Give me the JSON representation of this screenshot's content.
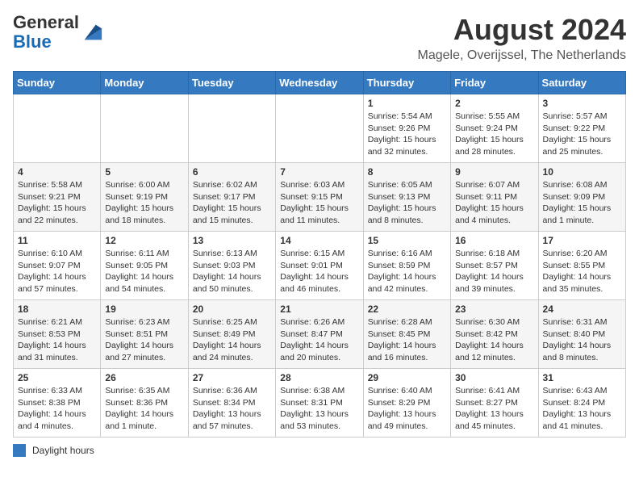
{
  "logo": {
    "general": "General",
    "blue": "Blue"
  },
  "title": "August 2024",
  "subtitle": "Magele, Overijssel, The Netherlands",
  "weekdays": [
    "Sunday",
    "Monday",
    "Tuesday",
    "Wednesday",
    "Thursday",
    "Friday",
    "Saturday"
  ],
  "weeks": [
    [
      {
        "day": "",
        "sunrise": "",
        "sunset": "",
        "daylight": ""
      },
      {
        "day": "",
        "sunrise": "",
        "sunset": "",
        "daylight": ""
      },
      {
        "day": "",
        "sunrise": "",
        "sunset": "",
        "daylight": ""
      },
      {
        "day": "",
        "sunrise": "",
        "sunset": "",
        "daylight": ""
      },
      {
        "day": "1",
        "sunrise": "Sunrise: 5:54 AM",
        "sunset": "Sunset: 9:26 PM",
        "daylight": "Daylight: 15 hours and 32 minutes."
      },
      {
        "day": "2",
        "sunrise": "Sunrise: 5:55 AM",
        "sunset": "Sunset: 9:24 PM",
        "daylight": "Daylight: 15 hours and 28 minutes."
      },
      {
        "day": "3",
        "sunrise": "Sunrise: 5:57 AM",
        "sunset": "Sunset: 9:22 PM",
        "daylight": "Daylight: 15 hours and 25 minutes."
      }
    ],
    [
      {
        "day": "4",
        "sunrise": "Sunrise: 5:58 AM",
        "sunset": "Sunset: 9:21 PM",
        "daylight": "Daylight: 15 hours and 22 minutes."
      },
      {
        "day": "5",
        "sunrise": "Sunrise: 6:00 AM",
        "sunset": "Sunset: 9:19 PM",
        "daylight": "Daylight: 15 hours and 18 minutes."
      },
      {
        "day": "6",
        "sunrise": "Sunrise: 6:02 AM",
        "sunset": "Sunset: 9:17 PM",
        "daylight": "Daylight: 15 hours and 15 minutes."
      },
      {
        "day": "7",
        "sunrise": "Sunrise: 6:03 AM",
        "sunset": "Sunset: 9:15 PM",
        "daylight": "Daylight: 15 hours and 11 minutes."
      },
      {
        "day": "8",
        "sunrise": "Sunrise: 6:05 AM",
        "sunset": "Sunset: 9:13 PM",
        "daylight": "Daylight: 15 hours and 8 minutes."
      },
      {
        "day": "9",
        "sunrise": "Sunrise: 6:07 AM",
        "sunset": "Sunset: 9:11 PM",
        "daylight": "Daylight: 15 hours and 4 minutes."
      },
      {
        "day": "10",
        "sunrise": "Sunrise: 6:08 AM",
        "sunset": "Sunset: 9:09 PM",
        "daylight": "Daylight: 15 hours and 1 minute."
      }
    ],
    [
      {
        "day": "11",
        "sunrise": "Sunrise: 6:10 AM",
        "sunset": "Sunset: 9:07 PM",
        "daylight": "Daylight: 14 hours and 57 minutes."
      },
      {
        "day": "12",
        "sunrise": "Sunrise: 6:11 AM",
        "sunset": "Sunset: 9:05 PM",
        "daylight": "Daylight: 14 hours and 54 minutes."
      },
      {
        "day": "13",
        "sunrise": "Sunrise: 6:13 AM",
        "sunset": "Sunset: 9:03 PM",
        "daylight": "Daylight: 14 hours and 50 minutes."
      },
      {
        "day": "14",
        "sunrise": "Sunrise: 6:15 AM",
        "sunset": "Sunset: 9:01 PM",
        "daylight": "Daylight: 14 hours and 46 minutes."
      },
      {
        "day": "15",
        "sunrise": "Sunrise: 6:16 AM",
        "sunset": "Sunset: 8:59 PM",
        "daylight": "Daylight: 14 hours and 42 minutes."
      },
      {
        "day": "16",
        "sunrise": "Sunrise: 6:18 AM",
        "sunset": "Sunset: 8:57 PM",
        "daylight": "Daylight: 14 hours and 39 minutes."
      },
      {
        "day": "17",
        "sunrise": "Sunrise: 6:20 AM",
        "sunset": "Sunset: 8:55 PM",
        "daylight": "Daylight: 14 hours and 35 minutes."
      }
    ],
    [
      {
        "day": "18",
        "sunrise": "Sunrise: 6:21 AM",
        "sunset": "Sunset: 8:53 PM",
        "daylight": "Daylight: 14 hours and 31 minutes."
      },
      {
        "day": "19",
        "sunrise": "Sunrise: 6:23 AM",
        "sunset": "Sunset: 8:51 PM",
        "daylight": "Daylight: 14 hours and 27 minutes."
      },
      {
        "day": "20",
        "sunrise": "Sunrise: 6:25 AM",
        "sunset": "Sunset: 8:49 PM",
        "daylight": "Daylight: 14 hours and 24 minutes."
      },
      {
        "day": "21",
        "sunrise": "Sunrise: 6:26 AM",
        "sunset": "Sunset: 8:47 PM",
        "daylight": "Daylight: 14 hours and 20 minutes."
      },
      {
        "day": "22",
        "sunrise": "Sunrise: 6:28 AM",
        "sunset": "Sunset: 8:45 PM",
        "daylight": "Daylight: 14 hours and 16 minutes."
      },
      {
        "day": "23",
        "sunrise": "Sunrise: 6:30 AM",
        "sunset": "Sunset: 8:42 PM",
        "daylight": "Daylight: 14 hours and 12 minutes."
      },
      {
        "day": "24",
        "sunrise": "Sunrise: 6:31 AM",
        "sunset": "Sunset: 8:40 PM",
        "daylight": "Daylight: 14 hours and 8 minutes."
      }
    ],
    [
      {
        "day": "25",
        "sunrise": "Sunrise: 6:33 AM",
        "sunset": "Sunset: 8:38 PM",
        "daylight": "Daylight: 14 hours and 4 minutes."
      },
      {
        "day": "26",
        "sunrise": "Sunrise: 6:35 AM",
        "sunset": "Sunset: 8:36 PM",
        "daylight": "Daylight: 14 hours and 1 minute."
      },
      {
        "day": "27",
        "sunrise": "Sunrise: 6:36 AM",
        "sunset": "Sunset: 8:34 PM",
        "daylight": "Daylight: 13 hours and 57 minutes."
      },
      {
        "day": "28",
        "sunrise": "Sunrise: 6:38 AM",
        "sunset": "Sunset: 8:31 PM",
        "daylight": "Daylight: 13 hours and 53 minutes."
      },
      {
        "day": "29",
        "sunrise": "Sunrise: 6:40 AM",
        "sunset": "Sunset: 8:29 PM",
        "daylight": "Daylight: 13 hours and 49 minutes."
      },
      {
        "day": "30",
        "sunrise": "Sunrise: 6:41 AM",
        "sunset": "Sunset: 8:27 PM",
        "daylight": "Daylight: 13 hours and 45 minutes."
      },
      {
        "day": "31",
        "sunrise": "Sunrise: 6:43 AM",
        "sunset": "Sunset: 8:24 PM",
        "daylight": "Daylight: 13 hours and 41 minutes."
      }
    ]
  ],
  "legend": {
    "color_label": "Daylight hours"
  }
}
